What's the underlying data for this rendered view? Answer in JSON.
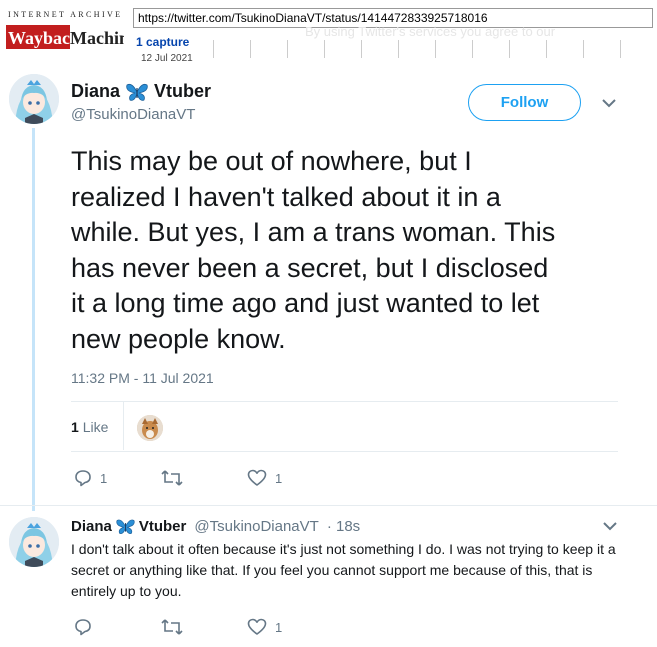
{
  "wayback": {
    "ia_label": "INTERNET ARCHIVE",
    "logo_label": "WaybackMachine",
    "url": "https://twitter.com/TsukinoDianaVT/status/1414472833925718016",
    "captures": "1 capture",
    "date": "12 Jul 2021",
    "ghost_text": "By using Twitter's services you agree to our"
  },
  "tweet": {
    "display_name_first": "Diana",
    "display_name_last": "Vtuber",
    "name_emoji_icon": "butterfly-icon",
    "handle": "@TsukinoDianaVT",
    "follow_label": "Follow",
    "text": "This may be out of nowhere, but I\nrealized I haven't talked about it in a\nwhile. But yes, I am a trans woman. This\nhas never been a secret, but I disclosed\nit a long time ago and just wanted to let\nnew people know.",
    "timestamp": "11:32 PM - 11 Jul 2021",
    "likes_number": "1",
    "likes_label": "Like",
    "reply_count": "1",
    "retweet_count": "",
    "like_count": "1"
  },
  "reply": {
    "display_name_first": "Diana",
    "display_name_last": "Vtuber",
    "handle": "@TsukinoDianaVT",
    "age": "· 18s",
    "text": "I don't talk about it often because it's just not something  I do. I was not trying to keep it a secret or anything like that. If you feel you cannot support me because of this, that is entirely up to you.",
    "reply_count": "",
    "retweet_count": "",
    "like_count": "1"
  },
  "colors": {
    "accent": "#1da1f2",
    "text_secondary": "#657786",
    "thread_line": "#c5e4f9",
    "wayback_red": "#c21e1e"
  }
}
